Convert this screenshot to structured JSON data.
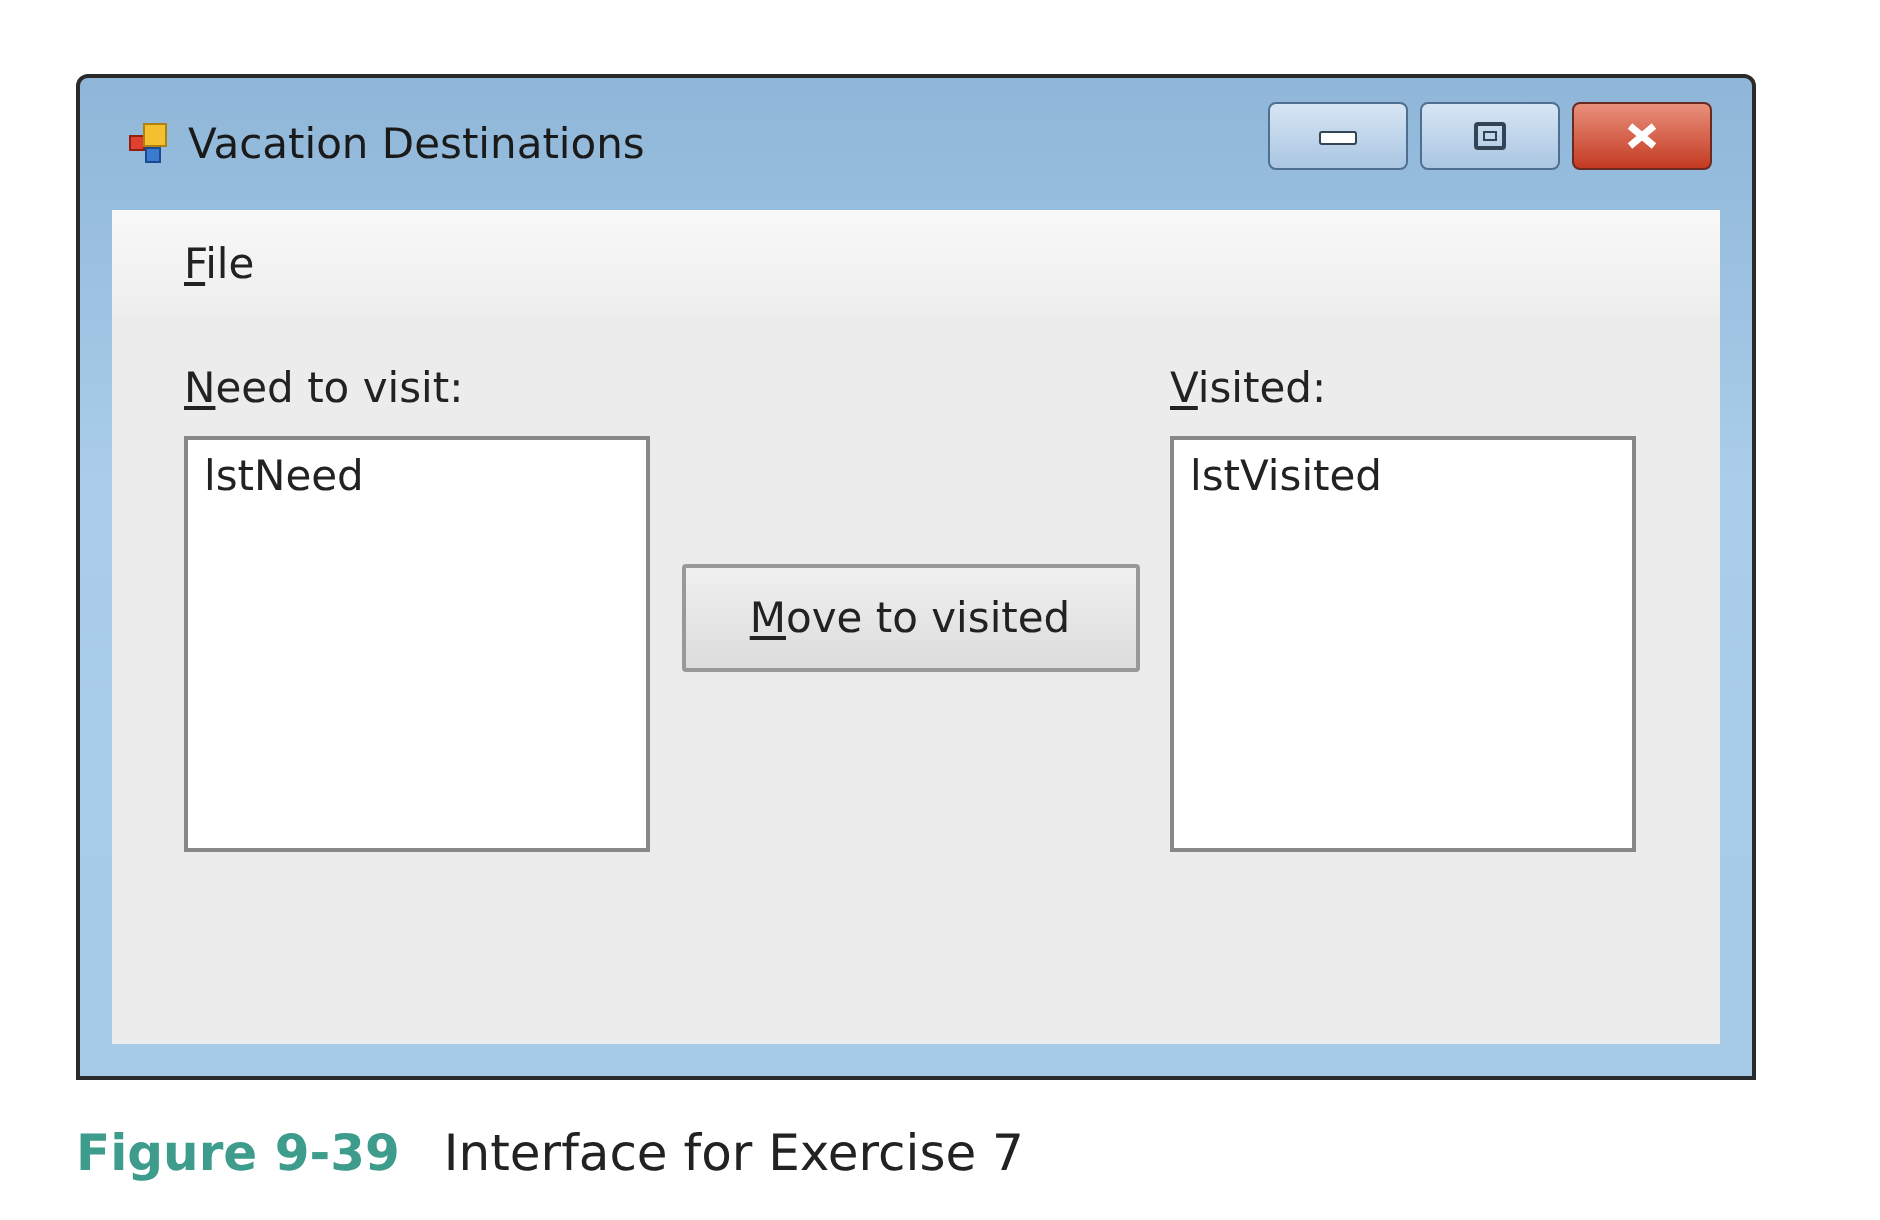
{
  "window": {
    "title": "Vacation Destinations"
  },
  "menu": [
    {
      "parts": [
        {
          "text": "F",
          "underlined": true
        },
        {
          "text": "ile",
          "underlined": false
        }
      ]
    }
  ],
  "left_list": {
    "label_parts": [
      {
        "text": "N",
        "underlined": true
      },
      {
        "text": "eed to visit:",
        "underlined": false
      }
    ],
    "items": [
      "lstNeed"
    ]
  },
  "button": {
    "parts": [
      {
        "text": "M",
        "underlined": true
      },
      {
        "text": "ove to visited",
        "underlined": false
      }
    ]
  },
  "right_list": {
    "label_parts": [
      {
        "text": "V",
        "underlined": true
      },
      {
        "text": "isited:",
        "underlined": false
      }
    ],
    "items": [
      "lstVisited"
    ]
  },
  "caption": {
    "number": "Figure 9-39",
    "text": "Interface for Exercise 7"
  }
}
